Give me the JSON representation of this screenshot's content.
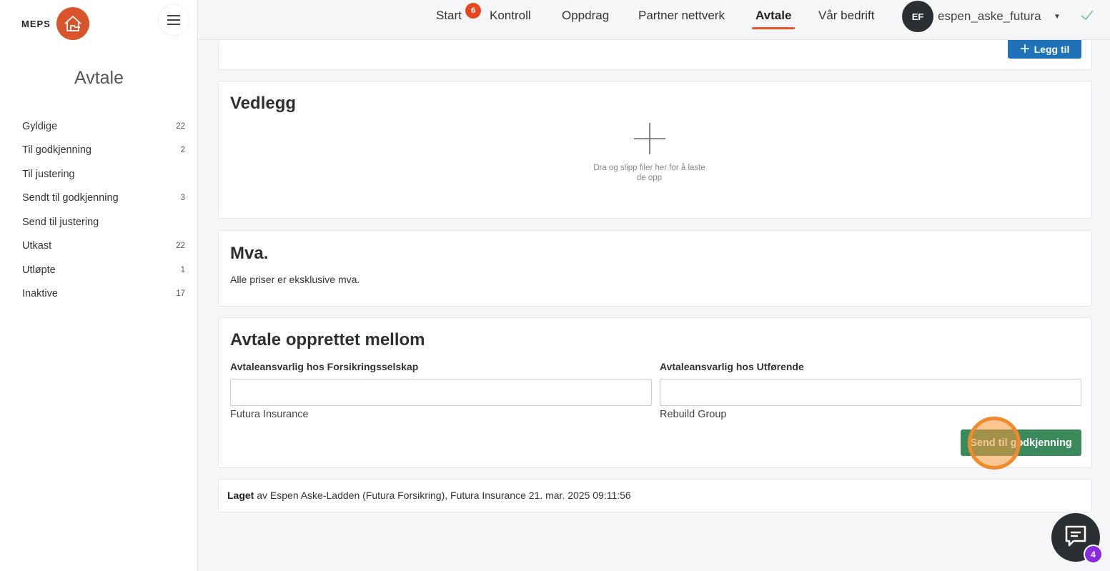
{
  "brand": {
    "name": "MEPS"
  },
  "sidebar": {
    "title": "Avtale",
    "items": [
      {
        "label": "Gyldige",
        "count": "22"
      },
      {
        "label": "Til godkjenning",
        "count": "2"
      },
      {
        "label": "Til justering",
        "count": ""
      },
      {
        "label": "Sendt til godkjenning",
        "count": "3"
      },
      {
        "label": "Send til justering",
        "count": ""
      },
      {
        "label": "Utkast",
        "count": "22"
      },
      {
        "label": "Utløpte",
        "count": "1"
      },
      {
        "label": "Inaktive",
        "count": "17"
      }
    ]
  },
  "nav": {
    "items": [
      "Start",
      "Kontroll",
      "Oppdrag",
      "Partner nettverk",
      "Avtale",
      "Vår bedrift"
    ],
    "active": "Avtale",
    "start_badge": "6",
    "avatar_initials": "EF",
    "username": "espen_aske_futura"
  },
  "top_card": {
    "add_label": "Legg til"
  },
  "vedlegg": {
    "title": "Vedlegg",
    "drop_text": "Dra og slipp filer her for å laste de opp"
  },
  "mva": {
    "title": "Mva.",
    "text": "Alle priser er eksklusive mva."
  },
  "agreement": {
    "title": "Avtale opprettet mellom",
    "left_label": "Avtaleansvarlig hos Forsikringsselskap",
    "left_company": "Futura Insurance",
    "right_label": "Avtaleansvarlig hos Utførende",
    "right_company": "Rebuild Group",
    "send_label": "Send til godkjenning"
  },
  "created": {
    "prefix": "Laget",
    "text": " av Espen Aske-Ladden (Futura Forsikring), Futura Insurance 21. mar. 2025 09:11:56"
  },
  "chat": {
    "badge": "4"
  },
  "colors": {
    "accent": "#e8542b",
    "primary": "#1f71b8",
    "success": "#3b8a5c",
    "chat_badge": "#8a2be2"
  }
}
